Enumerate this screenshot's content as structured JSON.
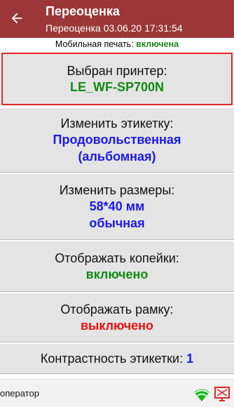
{
  "header": {
    "title": "Переоценка",
    "subtitle": "Переоценка 03.06.20 17:31:54",
    "back_icon": "arrow-left-icon"
  },
  "mobile_print": {
    "label": "Мобильная печать: ",
    "value": "включена"
  },
  "settings": {
    "printer": {
      "label": "Выбран принтер:",
      "value": "LE_WF-SP700N"
    },
    "label_type": {
      "label": "Изменить этикетку:",
      "value_line1": "Продовольственная",
      "value_line2": "(альбомная)"
    },
    "size": {
      "label": "Изменить размеры:",
      "value_line1": "58*40 мм",
      "value_line2": "обычная"
    },
    "kopecks": {
      "label": "Отображать копейки:",
      "value": "включено"
    },
    "frame": {
      "label": "Отображать рамку:",
      "value": "выключено"
    },
    "contrast": {
      "label": "Контрастность этикетки: ",
      "value": "1"
    }
  },
  "footer": {
    "operator": "оператор",
    "icons": [
      "wifi-icon",
      "printer-status-icon"
    ]
  },
  "colors": {
    "app_bar": "#9b3737",
    "on_value": "#118a11",
    "off_value": "#e81010",
    "info_value": "#1a1ae6",
    "highlight_border": "#e32626"
  }
}
